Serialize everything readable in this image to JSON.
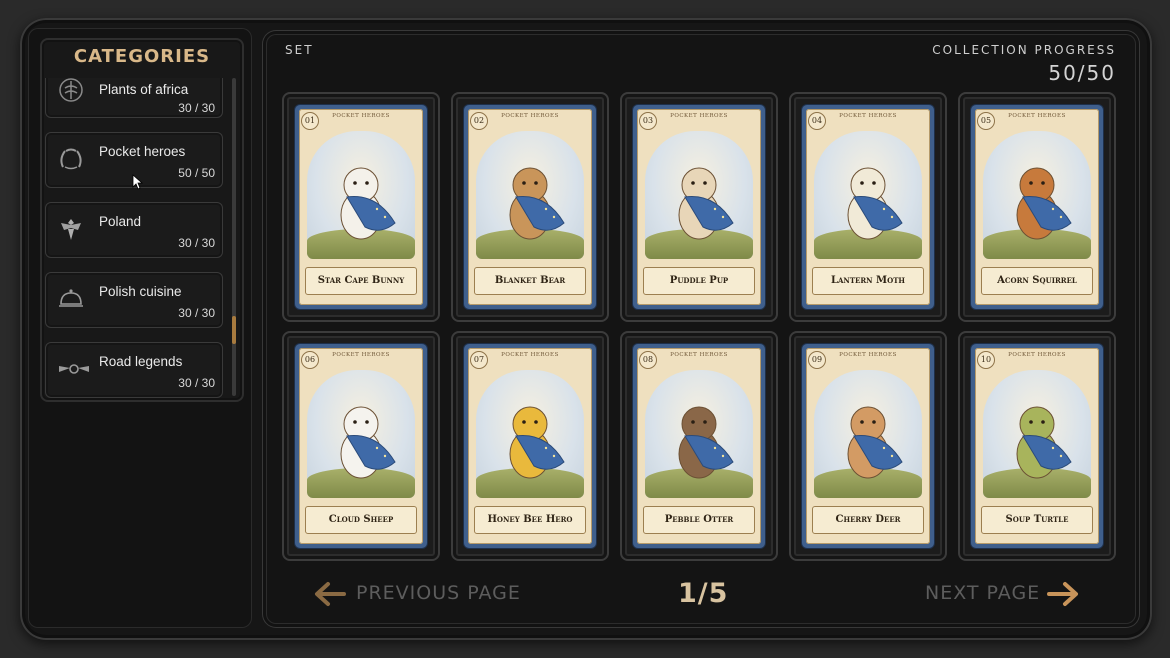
{
  "sidebar": {
    "title": "CATEGORIES",
    "items": [
      {
        "name": "Plants of africa",
        "count": "30 / 30",
        "icon": "plant-emblem-icon"
      },
      {
        "name": "Pocket heroes",
        "count": "50 / 50",
        "icon": "laurel-wreath-icon"
      },
      {
        "name": "Poland",
        "count": "30 / 30",
        "icon": "eagle-emblem-icon"
      },
      {
        "name": "Polish cuisine",
        "count": "30 / 30",
        "icon": "cloche-icon"
      },
      {
        "name": "Road legends",
        "count": "30 / 30",
        "icon": "winged-wheel-icon"
      }
    ]
  },
  "header": {
    "set_label": "SET",
    "progress_label": "COLLECTION PROGRESS",
    "progress_value": "50/50"
  },
  "cards": [
    {
      "number": "01",
      "series": "POCKET HEROES",
      "name": "Star Cape Bunny"
    },
    {
      "number": "02",
      "series": "POCKET HEROES",
      "name": "Blanket Bear"
    },
    {
      "number": "03",
      "series": "POCKET HEROES",
      "name": "Puddle Pup"
    },
    {
      "number": "04",
      "series": "POCKET HEROES",
      "name": "Lantern Moth"
    },
    {
      "number": "05",
      "series": "POCKET HEROES",
      "name": "Acorn Squirrel"
    },
    {
      "number": "06",
      "series": "POCKET HEROES",
      "name": "Cloud Sheep"
    },
    {
      "number": "07",
      "series": "POCKET HEROES",
      "name": "Honey Bee Hero"
    },
    {
      "number": "08",
      "series": "POCKET HEROES",
      "name": "Pebble Otter"
    },
    {
      "number": "09",
      "series": "POCKET HEROES",
      "name": "Cherry Deer"
    },
    {
      "number": "10",
      "series": "POCKET HEROES",
      "name": "Soup Turtle"
    }
  ],
  "pagination": {
    "prev_label": "PREVIOUS PAGE",
    "next_label": "NEXT PAGE",
    "page": "1/5"
  },
  "colors": {
    "accent": "#d9b889",
    "card_frame": "#3f5f8c",
    "scroll_thumb": "#a87b3f",
    "nav_arrow": "#b98a52"
  }
}
